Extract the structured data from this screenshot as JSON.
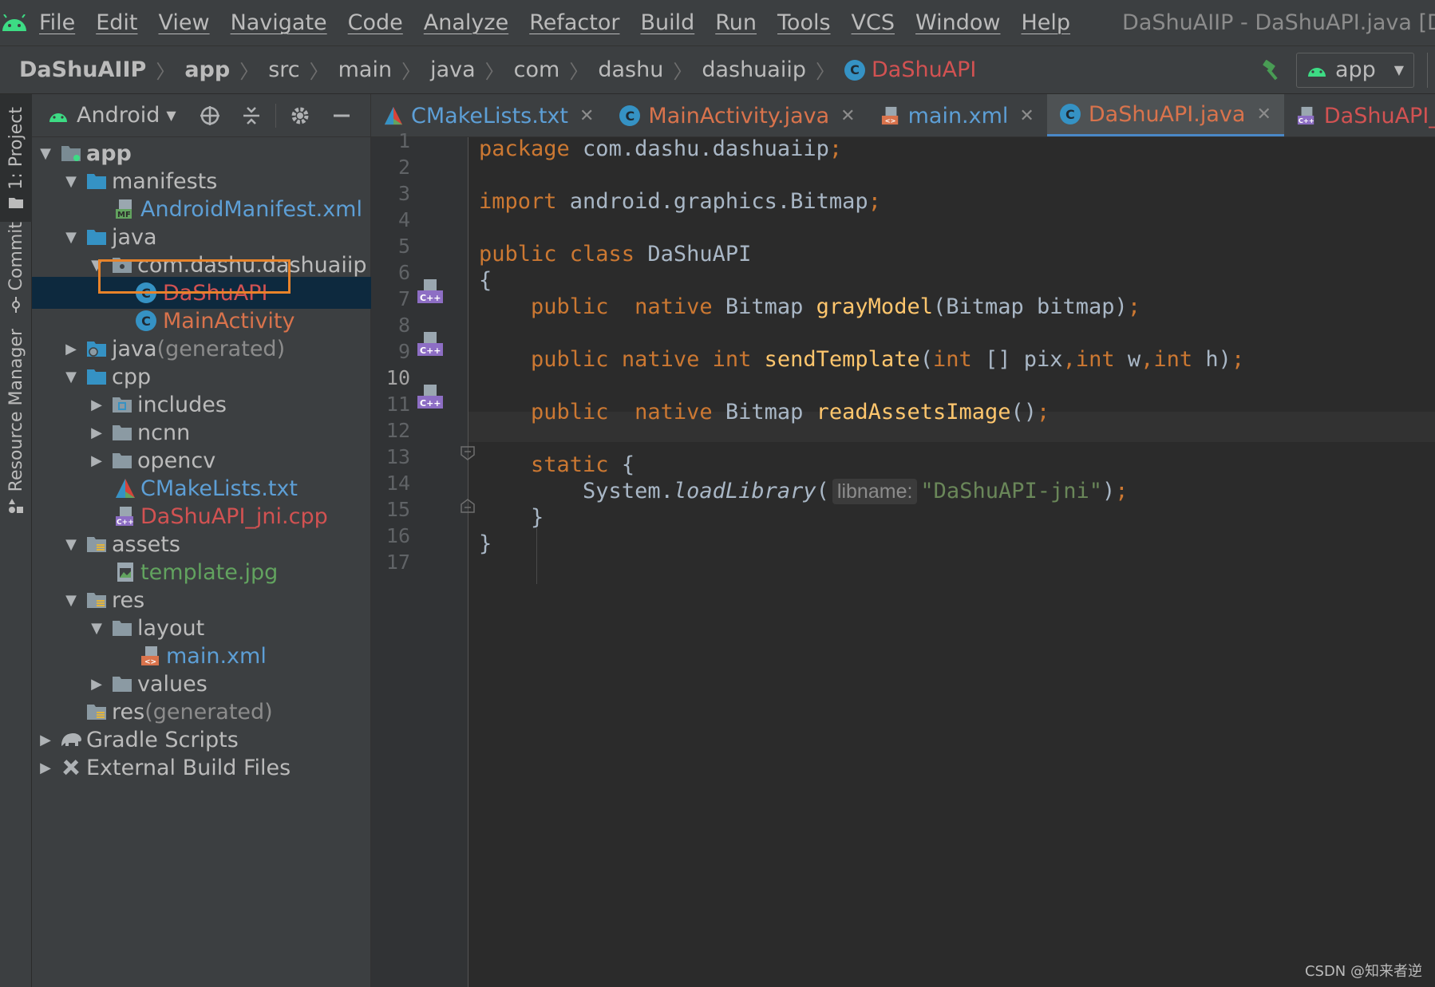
{
  "menubar": {
    "items": [
      "File",
      "Edit",
      "View",
      "Navigate",
      "Code",
      "Analyze",
      "Refactor",
      "Build",
      "Run",
      "Tools",
      "VCS",
      "Window",
      "Help"
    ],
    "window_title": "DaShuAIIP - DaShuAPI.java [DaShu"
  },
  "breadcrumbs": [
    "DaShuAIIP",
    "app",
    "src",
    "main",
    "java",
    "com",
    "dashu",
    "dashuaiip",
    "DaShuAPI"
  ],
  "run_config": {
    "label": "app"
  },
  "left_stripe": {
    "project": "1: Project",
    "commit": "Commit",
    "resource_manager": "Resource Manager"
  },
  "project_panel": {
    "view": "Android",
    "tree": [
      {
        "label": "app",
        "bold": true
      },
      {
        "label": "manifests"
      },
      {
        "label": "AndroidManifest.xml"
      },
      {
        "label": "java"
      },
      {
        "label": "com.dashu.dashuaiip"
      },
      {
        "label": "DaShuAPI",
        "selected": true
      },
      {
        "label": "MainActivity"
      },
      {
        "label": "java",
        "suffix": " (generated)"
      },
      {
        "label": "cpp"
      },
      {
        "label": "includes"
      },
      {
        "label": "ncnn"
      },
      {
        "label": "opencv"
      },
      {
        "label": "CMakeLists.txt"
      },
      {
        "label": "DaShuAPI_jni.cpp"
      },
      {
        "label": "assets"
      },
      {
        "label": "template.jpg"
      },
      {
        "label": "res"
      },
      {
        "label": "layout"
      },
      {
        "label": "main.xml"
      },
      {
        "label": "values"
      },
      {
        "label": "res",
        "suffix": " (generated)"
      },
      {
        "label": "Gradle Scripts"
      },
      {
        "label": "External Build Files"
      }
    ]
  },
  "tabs": [
    {
      "label": "CMakeLists.txt",
      "icon": "cmake-icon"
    },
    {
      "label": "MainActivity.java",
      "icon": "class-icon"
    },
    {
      "label": "main.xml",
      "icon": "xml-layout-icon"
    },
    {
      "label": "DaShuAPI.java",
      "icon": "class-icon",
      "active": true
    },
    {
      "label": "DaShuAPI_jni.cp",
      "icon": "cpp-file-icon"
    }
  ],
  "editor": {
    "line_numbers": [
      "1",
      "2",
      "3",
      "4",
      "5",
      "6",
      "7",
      "8",
      "9",
      "10",
      "11",
      "12",
      "13",
      "14",
      "15",
      "16",
      "17"
    ],
    "current_line": "10",
    "code": {
      "l1_kw": "package",
      "l1_rest": " com.dashu.dashuaiip",
      "l1_semi": ";",
      "l3_kw": "import",
      "l3_rest": " android.graphics.Bitmap",
      "l3_semi": ";",
      "l5_kw": "public class",
      "l5_rest": " DaShuAPI",
      "l6": "{",
      "l7_indent": "    ",
      "l7_kw": "public  native",
      "l7_type": " Bitmap ",
      "l7_fn": "grayModel",
      "l7_rest": "(Bitmap bitmap)",
      "l7_semi": ";",
      "l9_indent": "    ",
      "l9_kw": "public native int",
      "l9_sp": " ",
      "l9_fn": "sendTemplate",
      "l9_p1": "(",
      "l9_kw2": "int",
      "l9_p2": " [] pix",
      "l9_c1": ",",
      "l9_kw3": "int",
      "l9_p3": " w",
      "l9_c2": ",",
      "l9_kw4": "int",
      "l9_p4": " h)",
      "l9_semi": ";",
      "l11_indent": "    ",
      "l11_kw": "public  native",
      "l11_type": " Bitmap ",
      "l11_fn": "readAssetsImage",
      "l11_rest": "()",
      "l11_semi": ";",
      "l13_indent": "    ",
      "l13_kw": "static",
      "l13_rest": " {",
      "l14_indent": "        ",
      "l14_obj": "System.",
      "l14_fn": "loadLibrary",
      "l14_p": "(",
      "l14_hint": "libname:",
      "l14_str": "\"DaShuAPI-jni\"",
      "l14_end": ")",
      "l14_semi": ";",
      "l15_indent": "    ",
      "l15": "}",
      "l16": "}"
    }
  },
  "watermark": "CSDN @知来者逆",
  "colors": {
    "keyword": "#cc7832",
    "function": "#ffc66d",
    "string": "#6a8759",
    "default_text": "#a9b7c6",
    "selection_outline": "#e8832a",
    "active_tab_underline": "#4a88c7"
  }
}
